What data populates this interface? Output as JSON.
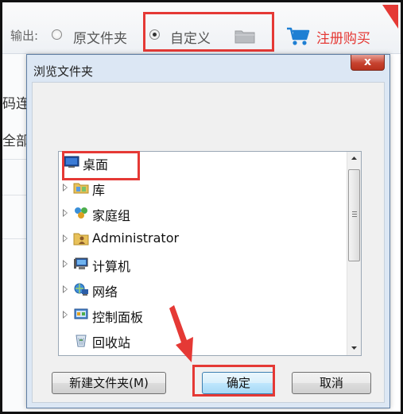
{
  "topbar": {
    "output_label": "输出:",
    "option_original": "原文件夹",
    "option_custom": "自定义",
    "register_label": "注册购买"
  },
  "background": {
    "partial_text_1": "码连",
    "partial_text_2": "全部"
  },
  "dialog": {
    "title": "浏览文件夹",
    "close_label": "x",
    "tree": [
      {
        "label": "桌面",
        "icon": "desktop-icon",
        "expandable": false
      },
      {
        "label": "库",
        "icon": "library-icon",
        "expandable": true
      },
      {
        "label": "家庭组",
        "icon": "homegroup-icon",
        "expandable": true
      },
      {
        "label": "Administrator",
        "icon": "user-folder-icon",
        "expandable": true
      },
      {
        "label": "计算机",
        "icon": "computer-icon",
        "expandable": true
      },
      {
        "label": "网络",
        "icon": "network-icon",
        "expandable": true
      },
      {
        "label": "控制面板",
        "icon": "control-panel-icon",
        "expandable": true
      },
      {
        "label": "回收站",
        "icon": "recycle-bin-icon",
        "expandable": false
      }
    ],
    "buttons": {
      "new_folder": "新建文件夹(M)",
      "ok": "确定",
      "cancel": "取消"
    }
  },
  "colors": {
    "annotation": "#e53935",
    "dialog_frame": "#dce7f4",
    "close_button": "#c7432f"
  }
}
